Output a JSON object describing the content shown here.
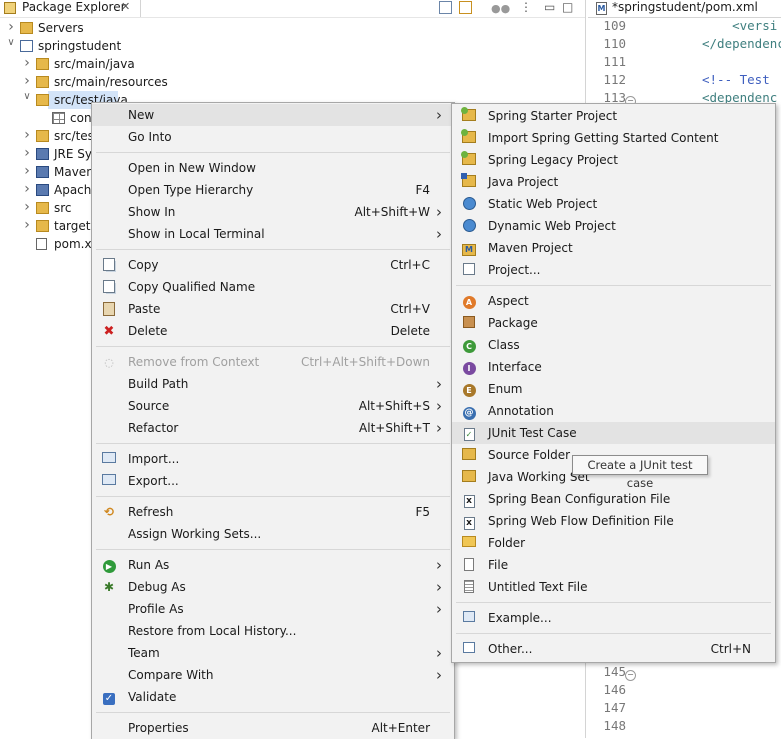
{
  "explorer": {
    "title": "Package Explorer",
    "tree": [
      {
        "label": "Servers",
        "indent": 0,
        "twisty": "collapsed"
      },
      {
        "label": "springstudent",
        "indent": 0,
        "twisty": "expanded"
      },
      {
        "label": "src/main/java",
        "indent": 1,
        "twisty": "collapsed"
      },
      {
        "label": "src/main/resources",
        "indent": 1,
        "twisty": "collapsed"
      },
      {
        "label": "src/test/java",
        "indent": 1,
        "twisty": "expanded"
      },
      {
        "label": "con",
        "indent": 2,
        "twisty": "none"
      },
      {
        "label": "src/tes",
        "indent": 1,
        "twisty": "collapsed"
      },
      {
        "label": "JRE Sys",
        "indent": 1,
        "twisty": "collapsed"
      },
      {
        "label": "Maven",
        "indent": 1,
        "twisty": "collapsed"
      },
      {
        "label": "Apache",
        "indent": 1,
        "twisty": "collapsed"
      },
      {
        "label": "src",
        "indent": 1,
        "twisty": "collapsed"
      },
      {
        "label": "target",
        "indent": 1,
        "twisty": "collapsed"
      },
      {
        "label": "pom.x",
        "indent": 1,
        "twisty": "none"
      }
    ]
  },
  "editor": {
    "tab": "*springstudent/pom.xml",
    "lines": [
      {
        "num": "109",
        "code": "    <versi"
      },
      {
        "num": "110",
        "code": "</dependenc"
      },
      {
        "num": "111",
        "code": ""
      },
      {
        "num": "112",
        "code": "<!-- Test"
      },
      {
        "num": "113",
        "code": "<dependenc"
      },
      {
        "num": "145",
        "code": ""
      },
      {
        "num": "146",
        "code": ""
      },
      {
        "num": "147",
        "code": ""
      },
      {
        "num": "148",
        "code": ""
      }
    ]
  },
  "context_menu": {
    "items": [
      {
        "label": "New",
        "shortcut": "",
        "submenu": true,
        "icon": "",
        "highlight": true
      },
      {
        "label": "Go Into",
        "shortcut": "",
        "submenu": false,
        "icon": ""
      },
      {
        "sep": true
      },
      {
        "label": "Open in New Window",
        "shortcut": "",
        "submenu": false,
        "icon": ""
      },
      {
        "label": "Open Type Hierarchy",
        "shortcut": "F4",
        "submenu": false,
        "icon": ""
      },
      {
        "label": "Show In",
        "shortcut": "Alt+Shift+W",
        "submenu": true,
        "icon": ""
      },
      {
        "label": "Show in Local Terminal",
        "shortcut": "",
        "submenu": true,
        "icon": ""
      },
      {
        "sep": true
      },
      {
        "label": "Copy",
        "shortcut": "Ctrl+C",
        "submenu": false,
        "icon": "copy-icon"
      },
      {
        "label": "Copy Qualified Name",
        "shortcut": "",
        "submenu": false,
        "icon": "copy-icon"
      },
      {
        "label": "Paste",
        "shortcut": "Ctrl+V",
        "submenu": false,
        "icon": "paste-icon"
      },
      {
        "label": "Delete",
        "shortcut": "Delete",
        "submenu": false,
        "icon": "delete-icon"
      },
      {
        "sep": true
      },
      {
        "label": "Remove from Context",
        "shortcut": "Ctrl+Alt+Shift+Down",
        "submenu": false,
        "icon": "remove-context-icon",
        "disabled": true
      },
      {
        "label": "Build Path",
        "shortcut": "",
        "submenu": true,
        "icon": ""
      },
      {
        "label": "Source",
        "shortcut": "Alt+Shift+S",
        "submenu": true,
        "icon": ""
      },
      {
        "label": "Refactor",
        "shortcut": "Alt+Shift+T",
        "submenu": true,
        "icon": ""
      },
      {
        "sep": true
      },
      {
        "label": "Import...",
        "shortcut": "",
        "submenu": false,
        "icon": "import-icon"
      },
      {
        "label": "Export...",
        "shortcut": "",
        "submenu": false,
        "icon": "export-icon"
      },
      {
        "sep": true
      },
      {
        "label": "Refresh",
        "shortcut": "F5",
        "submenu": false,
        "icon": "refresh-icon"
      },
      {
        "label": "Assign Working Sets...",
        "shortcut": "",
        "submenu": false,
        "icon": ""
      },
      {
        "sep": true
      },
      {
        "label": "Run As",
        "shortcut": "",
        "submenu": true,
        "icon": "run-icon"
      },
      {
        "label": "Debug As",
        "shortcut": "",
        "submenu": true,
        "icon": "debug-icon"
      },
      {
        "label": "Profile As",
        "shortcut": "",
        "submenu": true,
        "icon": ""
      },
      {
        "label": "Restore from Local History...",
        "shortcut": "",
        "submenu": false,
        "icon": ""
      },
      {
        "label": "Team",
        "shortcut": "",
        "submenu": true,
        "icon": ""
      },
      {
        "label": "Compare With",
        "shortcut": "",
        "submenu": true,
        "icon": ""
      },
      {
        "label": "Validate",
        "shortcut": "",
        "submenu": false,
        "icon": "check-icon"
      },
      {
        "sep": true
      },
      {
        "label": "Properties",
        "shortcut": "Alt+Enter",
        "submenu": false,
        "icon": ""
      }
    ]
  },
  "submenu": {
    "items": [
      {
        "label": "Spring Starter Project",
        "shortcut": "",
        "icon": "spring-project-icon"
      },
      {
        "label": "Import Spring Getting Started Content",
        "shortcut": "",
        "icon": "spring-project-icon"
      },
      {
        "label": "Spring Legacy Project",
        "shortcut": "",
        "icon": "spring-project-icon"
      },
      {
        "label": "Java Project",
        "shortcut": "",
        "icon": "java-project-icon"
      },
      {
        "label": "Static Web Project",
        "shortcut": "",
        "icon": "web-project-icon"
      },
      {
        "label": "Dynamic Web Project",
        "shortcut": "",
        "icon": "web-project-icon"
      },
      {
        "label": "Maven Project",
        "shortcut": "",
        "icon": "maven-project-icon"
      },
      {
        "label": "Project...",
        "shortcut": "",
        "icon": "project-icon"
      },
      {
        "sep": true
      },
      {
        "label": "Aspect",
        "shortcut": "",
        "icon": "aspect-icon"
      },
      {
        "label": "Package",
        "shortcut": "",
        "icon": "package-icon"
      },
      {
        "label": "Class",
        "shortcut": "",
        "icon": "class-icon"
      },
      {
        "label": "Interface",
        "shortcut": "",
        "icon": "interface-icon"
      },
      {
        "label": "Enum",
        "shortcut": "",
        "icon": "enum-icon"
      },
      {
        "label": "Annotation",
        "shortcut": "",
        "icon": "annotation-icon"
      },
      {
        "label": "JUnit Test Case",
        "shortcut": "",
        "icon": "junit-icon",
        "highlight": true
      },
      {
        "label": "Source Folder",
        "shortcut": "",
        "icon": "source-folder-icon"
      },
      {
        "label": "Java Working Set",
        "shortcut": "",
        "icon": "working-set-icon"
      },
      {
        "label": "Spring Bean Configuration File",
        "shortcut": "",
        "icon": "xml-file-icon"
      },
      {
        "label": "Spring Web Flow Definition File",
        "shortcut": "",
        "icon": "xml-file-icon"
      },
      {
        "label": "Folder",
        "shortcut": "",
        "icon": "folder-icon"
      },
      {
        "label": "File",
        "shortcut": "",
        "icon": "file-icon"
      },
      {
        "label": "Untitled Text File",
        "shortcut": "",
        "icon": "text-file-icon"
      },
      {
        "sep": true
      },
      {
        "label": "Example...",
        "shortcut": "",
        "icon": "example-icon"
      },
      {
        "sep": true
      },
      {
        "label": "Other...",
        "shortcut": "Ctrl+N",
        "icon": "other-icon"
      }
    ]
  },
  "tooltip": "Create a JUnit test case"
}
